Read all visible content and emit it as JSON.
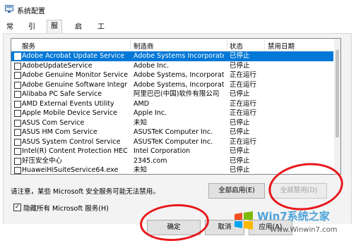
{
  "window": {
    "title": "系统配置",
    "icon": "msconfig-icon"
  },
  "tabs": [
    "常规",
    "引导",
    "服务",
    "启动",
    "工具"
  ],
  "active_tab": "服务",
  "table": {
    "headers": {
      "service": "服务",
      "manufacturer": "制造商",
      "status": "状态",
      "disabled_date": "禁用日期"
    },
    "rows": [
      {
        "name": "Adobe Acrobat Update Service",
        "manufacturer": "Adobe Systems Incorporated",
        "status": "已停止",
        "date": "",
        "checked": false,
        "selected": true
      },
      {
        "name": "AdobeUpdateService",
        "manufacturer": "Adobe Inc.",
        "status": "已停止",
        "date": "",
        "checked": false,
        "selected": false
      },
      {
        "name": "Adobe Genuine Monitor Service",
        "manufacturer": "Adobe Systems, Incorporated",
        "status": "正在运行",
        "date": "",
        "checked": false,
        "selected": false
      },
      {
        "name": "Adobe Genuine Software Integrity...",
        "manufacturer": "Adobe Systems, Incorporated",
        "status": "正在运行",
        "date": "",
        "checked": false,
        "selected": false
      },
      {
        "name": "Alibaba PC Safe Service",
        "manufacturer": "阿里巴巴(中国)软件有限公司",
        "status": "已停止",
        "date": "",
        "checked": false,
        "selected": false
      },
      {
        "name": "AMD External Events Utility",
        "manufacturer": "AMD",
        "status": "正在运行",
        "date": "",
        "checked": false,
        "selected": false
      },
      {
        "name": "Apple Mobile Device Service",
        "manufacturer": "Apple Inc.",
        "status": "正在运行",
        "date": "",
        "checked": false,
        "selected": false
      },
      {
        "name": "ASUS Com Service",
        "manufacturer": "未知",
        "status": "已停止",
        "date": "",
        "checked": false,
        "selected": false
      },
      {
        "name": "ASUS HM Com Service",
        "manufacturer": "ASUSTeK Computer Inc.",
        "status": "已停止",
        "date": "",
        "checked": false,
        "selected": false
      },
      {
        "name": "ASUS System Control Service",
        "manufacturer": "ASUSTeK Computer Inc.",
        "status": "正在运行",
        "date": "",
        "checked": false,
        "selected": false
      },
      {
        "name": "Intel(R) Content Protection HECI S...",
        "manufacturer": "Intel Corporation",
        "status": "已停止",
        "date": "",
        "checked": false,
        "selected": false
      },
      {
        "name": "好压安全中心",
        "manufacturer": "2345.com",
        "status": "已停止",
        "date": "",
        "checked": false,
        "selected": false
      },
      {
        "name": "HuaweiHiSuiteService64.exe",
        "manufacturer": "未知",
        "status": "已停止",
        "date": "",
        "checked": false,
        "selected": false
      }
    ]
  },
  "notice": "请注意，某些 Microsoft 安全服务可能无法禁用。",
  "buttons": {
    "enable_all": "全部启用(E)",
    "disable_all": "全部禁用(D)",
    "ok": "确定",
    "cancel": "取消",
    "apply": "应用(A)"
  },
  "hide_ms": {
    "label": "隐藏所有 Microsoft 服务(H)",
    "checked": true
  },
  "watermark": {
    "text": "Win7系统之家",
    "url": "Www.Winwin7.com"
  },
  "colors": {
    "selection": "#0078d7",
    "annotation_red": "#e8171b",
    "watermark_blue": "#4ca2d9"
  }
}
